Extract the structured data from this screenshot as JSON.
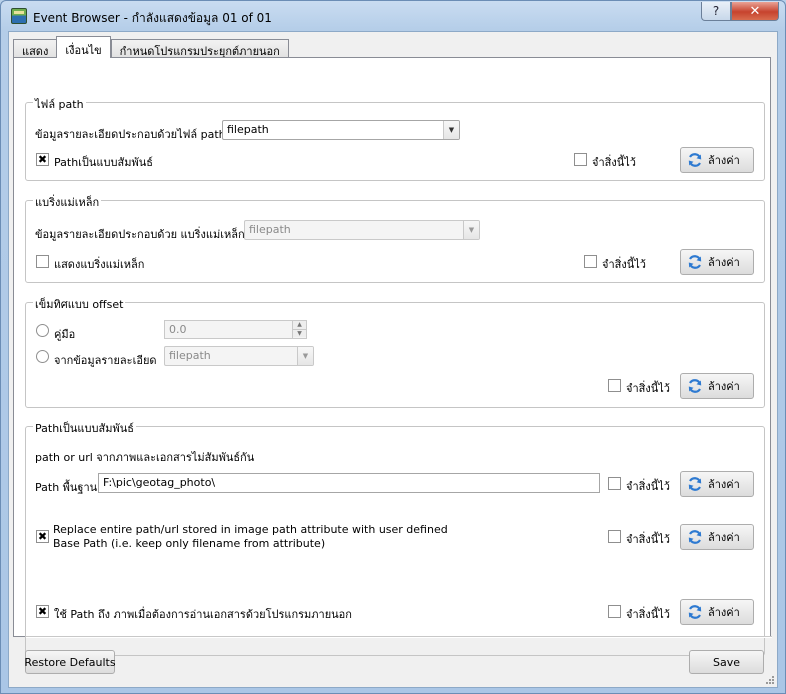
{
  "window": {
    "title": "Event Browser - กำลังแสดงข้อมูล 01 of 01",
    "help_label": "?",
    "close_label": "✕"
  },
  "tabs": [
    {
      "label": "แสดง",
      "active": false
    },
    {
      "label": "เงื่อนไข",
      "active": true
    },
    {
      "label": "กำหนดโปรแกรมประยุกต์ภายนอก",
      "active": false
    }
  ],
  "common": {
    "remember_label": "จำสิ่งนี้ไว้",
    "reset_label": "ล้างค่า"
  },
  "file_path_group": {
    "title": "ไฟล์ path",
    "field_label": "ข้อมูลรายละเอียดประกอบด้วยไฟล์ path",
    "field_value": "filepath",
    "relative_label": "Pathเป็นแบบสัมพันธ์",
    "relative_checked": true,
    "remember_checked": false
  },
  "compass_group": {
    "title": "แบริ่งแม่เหล็ก",
    "field_label": "ข้อมูลรายละเอียดประกอบด้วย แบริ่งแม่เหล็ก",
    "field_value": "filepath",
    "show_label": "แสดงแบริ่งแม่เหล็ก",
    "show_checked": false,
    "remember_checked": false
  },
  "offset_group": {
    "title": "เข็มทิศแบบ offset",
    "manual_label": "คู่มือ",
    "manual_value": "0.0",
    "from_attr_label": "จากข้อมูลรายละเอียด",
    "from_attr_value": "filepath",
    "remember_checked": false
  },
  "relative_group": {
    "title": "Pathเป็นแบบสัมพันธ์",
    "description": "path or url จากภาพและเอกสารไม่สัมพันธ์กัน",
    "base_path_label": "Path พื้นฐาน",
    "base_path_value": "F:\\pic\\geotag_photo\\",
    "replace_label_line1": "Replace entire path/url stored in image path attribute with user defined",
    "replace_label_line2": "Base Path (i.e. keep only filename from attribute)",
    "replace_checked": true,
    "external_label": "ใช้ Path ถึง ภาพเมื่อต้องการอ่านเอกสารด้วยโปรแกรมภายนอก",
    "external_checked": true
  },
  "footer": {
    "restore_label": "Restore Defaults",
    "save_label": "Save"
  },
  "icons": {
    "app": "event-browser-icon",
    "refresh": "refresh-icon"
  }
}
